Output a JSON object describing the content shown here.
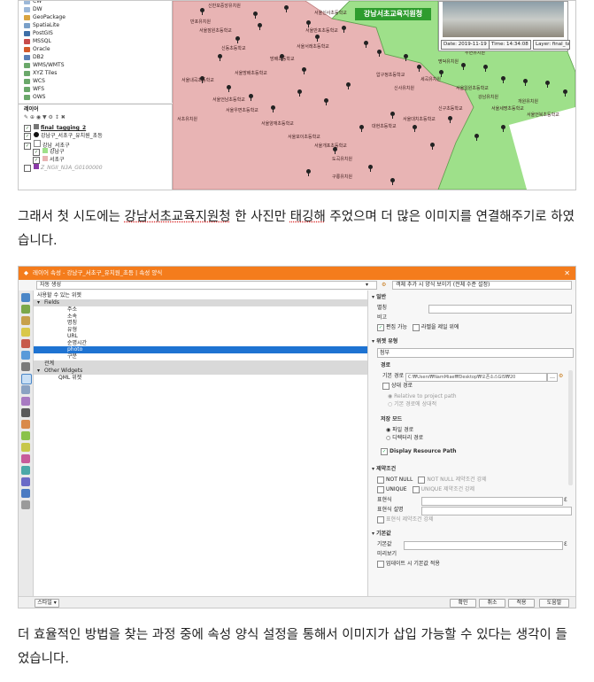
{
  "top_screenshot": {
    "browser_items": [
      "CW",
      "DW",
      "GeoPackage",
      "SpatiaLite",
      "PostGIS",
      "MSSQL",
      "Oracle",
      "DB2",
      "WMS/WMTS",
      "XYZ Tiles",
      "WCS",
      "WFS",
      "OWS"
    ],
    "layers_title": "레이어",
    "layers": [
      {
        "label": "final_tagging_2",
        "checked": true,
        "bold": true
      },
      {
        "label": "강남구_서초구_유치원_초등",
        "checked": true,
        "bold": false
      },
      {
        "label": "강남_서초구",
        "checked": true,
        "bold": false
      },
      {
        "label": "강남구",
        "checked": true,
        "bold": false
      },
      {
        "label": "서초구",
        "checked": true,
        "bold": false
      },
      {
        "label": "Z_NGII_N3A_G0100000",
        "checked": false,
        "bold": false
      }
    ],
    "callout": "강남서초교육지원청",
    "photo_date": "Date: 2019-11-19",
    "photo_time": "Time: 14:34:08",
    "photo_layer": "Layer: final_tagging",
    "map_labels": [
      "신반포중앙유치원",
      "반포유치원",
      "서울잠원초등학교",
      "신동초등학교",
      "서울신사초등학교",
      "서울반포초등학교",
      "서울서래초등학교",
      "방배초등학교",
      "서울방배초등학교",
      "서울내곡초등학교",
      "서울언남초등학교",
      "서울우면초등학교",
      "서울양재초등학교",
      "서울포이초등학교",
      "서울개포초등학교",
      "도곡유치원",
      "구룡유치원",
      "대현초등학교",
      "서울대치초등학교",
      "신구초등학교",
      "서울일원초등학교",
      "강남유치원",
      "서울세명초등학교",
      "개원유치원",
      "서울언북초등학교",
      "압구정초등학교",
      "신사유치원",
      "세곡유치원",
      "명덕유치원",
      "우면유치원",
      "서초유치원"
    ],
    "colors": {
      "seocho": "#e8b4b4",
      "gangnam": "#9ee08a",
      "callout": "#2e9c2e"
    }
  },
  "paragraph1": {
    "before": "그래서 첫 시도에는 ",
    "u1": "강남서초교육지원청",
    "mid": " 한 사진만 ",
    "u2": "태깅해",
    "after": " 주었으며 더 많은 이미지를 연결해주기로 하였습니다."
  },
  "dialog": {
    "title": "레이어 속성 - 강남구_서초구_유치원_초등 | 속성 양식",
    "toolbar_left": "자동 생성",
    "toolbar_right": "객체 추가 시 양식 보이기 (전체 수준 설정)",
    "tree": {
      "header": "사용할 수 있는 위젯",
      "fields_label": "Fields",
      "fields": [
        "주소",
        "소속",
        "명칭",
        "유형",
        "URL",
        "순명시간",
        "photo",
        "구분"
      ],
      "relations_label": "관계",
      "other_label": "Other Widgets",
      "other_items": [
        "QML 위젯"
      ]
    },
    "props": {
      "general_title": "일반",
      "alias_label": "별칭",
      "comment_label": "비고",
      "editable_label": "편집 가능",
      "label_on_top": "라벨을 제일 위에",
      "widget_type_title": "위젯 유형",
      "widget_type_value": "첨부",
      "path_title": "경로",
      "default_path_label": "기본 경로",
      "default_path_value": "C:₩Users₩NamMiae₩Desktop₩오픈소스GIS₩20",
      "relative_path_label": "상대 경로",
      "relative_option_1": "Relative to project path",
      "relative_option_2": "기본 경로에 상대적",
      "storage_mode_title": "저장 모드",
      "storage_option_1": "파일 경로",
      "storage_option_2": "디렉터리 경로",
      "display_resource": "Display Resource Path",
      "constraints_title": "제약조건",
      "not_null_label": "NOT NULL",
      "not_null_enforce": "NOT NULL 제약조건 강제",
      "unique_label": "UNIQUE",
      "unique_enforce": "UNIQUE 제약조건 강제",
      "expression_label": "표현식",
      "expression_desc_label": "표현식 설명",
      "expression_enforce": "표현식 제약조건 강제",
      "defaults_title": "기본값",
      "default_value_label": "기본값",
      "preview_label": "미리보기",
      "apply_on_update": "업데이트 시 기본값 적용"
    },
    "buttons": {
      "style": "스타일",
      "ok": "확인",
      "cancel": "취소",
      "apply": "적용",
      "help": "도움말"
    },
    "colors": {
      "titlebar": "#f47c1c",
      "selected": "#1e73d2",
      "header_bg": "#d9d9d9"
    }
  },
  "paragraph2": "더 효율적인 방법을 찾는 과정 중에 속성 양식 설정을 통해서 이미지가 삽입 가능할 수 있다는 생각이 들었습니다."
}
